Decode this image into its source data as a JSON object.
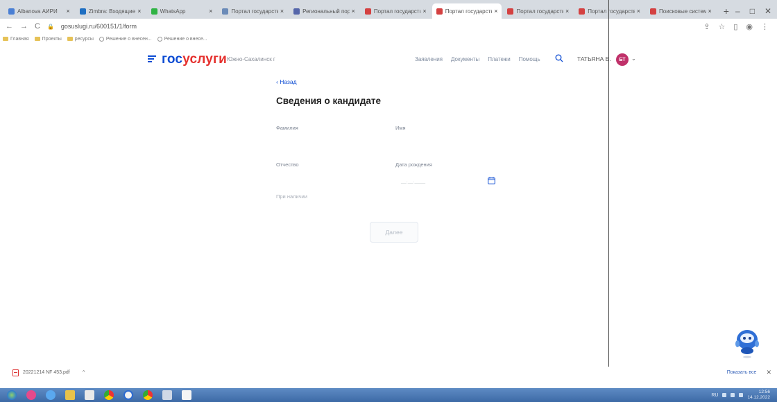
{
  "browser": {
    "tabs": [
      {
        "title": "Albanova АИРИ",
        "active": false,
        "color": "#4a7fd4"
      },
      {
        "title": "Zimbra: Входящие",
        "active": false,
        "color": "#1f6fc2"
      },
      {
        "title": "WhatsApp",
        "active": false,
        "color": "#2fb344"
      },
      {
        "title": "Портал государственн",
        "active": false,
        "color": "#6b8bb8"
      },
      {
        "title": "Региональный портал",
        "active": false,
        "color": "#5566aa"
      },
      {
        "title": "Портал государствен",
        "active": false,
        "color": "#d44141"
      },
      {
        "title": "Портал государствен",
        "active": true,
        "color": "#d44141"
      },
      {
        "title": "Портал государствен",
        "active": false,
        "color": "#d44141"
      },
      {
        "title": "Портал государствен",
        "active": false,
        "color": "#d44141"
      },
      {
        "title": "Поисковые системы",
        "active": false,
        "color": "#d44141"
      }
    ],
    "url": "gosuslugi.ru/600151/1/form",
    "bookmarks": [
      {
        "label": "Главная",
        "kind": "folder"
      },
      {
        "label": "Проекты",
        "kind": "folder"
      },
      {
        "label": "ресурсы",
        "kind": "folder"
      },
      {
        "label": "Решение о внесен...",
        "kind": "globe"
      },
      {
        "label": "Решение о внесе...",
        "kind": "globe"
      }
    ]
  },
  "site": {
    "logo_part1": "гос",
    "logo_part2": "услуги",
    "region": "Южно-Сахалинск г",
    "nav": [
      "Заявления",
      "Документы",
      "Платежи",
      "Помощь"
    ],
    "user_name": "ТАТЬЯНА Б.",
    "user_initials": "БТ"
  },
  "form": {
    "back_label": "‹ Назад",
    "title": "Сведения о кандидате",
    "fields": {
      "surname": "Фамилия",
      "name": "Имя",
      "patronymic": "Отчество",
      "birth_date": "Дата рождения",
      "birth_date_placeholder": "__.__.____",
      "if_present": "При наличии"
    },
    "next_button": "Далее"
  },
  "downloads": {
    "file_name": "20221214 NF 453.pdf",
    "show_all": "Показать все"
  },
  "taskbar": {
    "lang": "RU",
    "time": "12:56",
    "date": "14.12.2022"
  }
}
